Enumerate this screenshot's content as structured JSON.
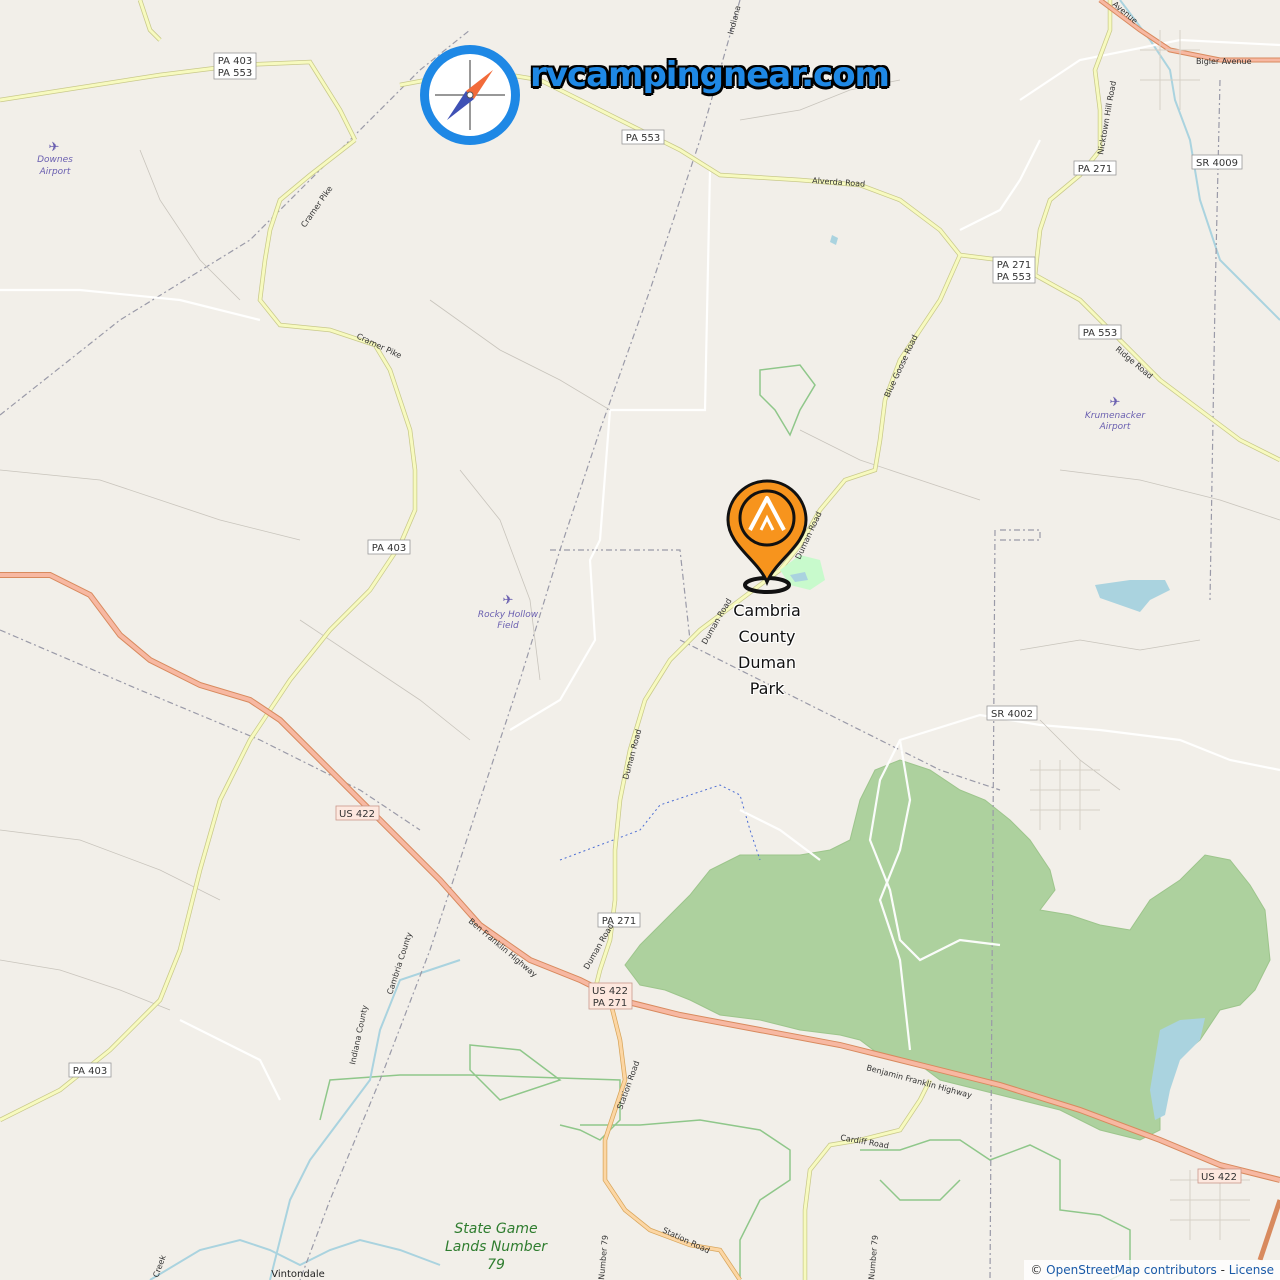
{
  "brand": {
    "name": "rvcampingnear.com",
    "icon": "compass-icon"
  },
  "poi": {
    "name_lines": [
      "Cambria",
      "County",
      "Duman",
      "Park"
    ],
    "icon": "campground-pin-icon",
    "pin_color": "#f7941d"
  },
  "shields": {
    "pa403_553_top": [
      "PA 403",
      "PA 553"
    ],
    "pa553_a": "PA 553",
    "pa271_top": "PA 271",
    "sr4009": "SR 4009",
    "pa271_553": [
      "PA 271",
      "PA 553"
    ],
    "pa553_b": "PA 553",
    "pa403_mid": "PA 403",
    "sr4002": "SR 4002",
    "us422_a": "US 422",
    "pa271_low": "PA 271",
    "us422_pa271": [
      "US 422",
      "PA 271"
    ],
    "pa403_low": "PA 403",
    "us422_b": "US 422"
  },
  "road_labels": {
    "indiana": "Indiana",
    "bigler": "Bigler Avenue",
    "alverda": "Alverda Road",
    "cramer1": "Cramer Pike",
    "cramer2": "Cramer Pike",
    "nicktown": "Nicktown Hill Road",
    "blue_goose": "Blue Goose Road",
    "ridge": "Ridge Road",
    "duman1": "Duman Road",
    "duman2": "Duman Road",
    "duman3": "Duman Road",
    "duman4": "Duman Road",
    "ben_franklin1": "Ben Franklin Highway",
    "ben_franklin2": "Benjamin Franklin Highway",
    "cardiff": "Cardiff Road",
    "station1": "Station Road",
    "station2": "Station Road",
    "number79a": "Number 79",
    "number79b": "Number 79",
    "cambria_county": "Cambria County",
    "indiana_county": "Indiana County",
    "avenue": "Avenue",
    "creek": "Creek"
  },
  "airports": {
    "downes": [
      "Downes",
      "Airport"
    ],
    "rocky": [
      "Rocky Hollow",
      "Field"
    ],
    "krumenacker": [
      "Krumenacker",
      "Airport"
    ]
  },
  "places": {
    "state_game_lands": [
      "State Game",
      "Lands Number",
      "79"
    ],
    "vintondale": "Vintondale"
  },
  "attribution": {
    "prefix": "© ",
    "osm": "OpenStreetMap contributors",
    "sep": " - ",
    "license": "License"
  },
  "colors": {
    "background": "#f2efe9",
    "forest": "#add19e",
    "water": "#aad3df",
    "primary_road": "#f7c6a6",
    "secondary_road": "#f7fabf",
    "brand": "#1e88e5"
  }
}
